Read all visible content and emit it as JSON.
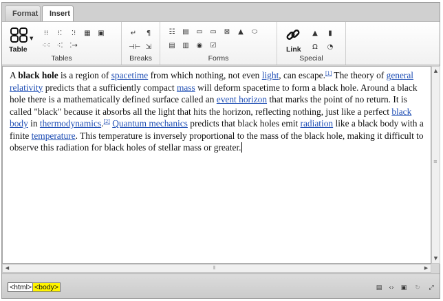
{
  "tabs": [
    {
      "label": "Format",
      "active": false
    },
    {
      "label": "Insert",
      "active": true
    }
  ],
  "ribbon": {
    "groups": {
      "tables": "Tables",
      "breaks": "Breaks",
      "forms": "Forms",
      "special": "Special"
    },
    "table_label": "Table",
    "link_label": "Link"
  },
  "content": {
    "p1": "A ",
    "b1": "black hole",
    "p2": " is a region of ",
    "l_spacetime": "spacetime",
    "p3": " from which nothing, not even ",
    "l_light": "light",
    "p4": ", can escape.",
    "sup1": "[1]",
    "p5": " The theory of ",
    "l_gr": "general relativity",
    "p6": " predicts that a sufficiently compact ",
    "l_mass": "mass",
    "p7": " will deform spacetime to form a black hole. Around a black hole there is a mathematically defined surface called an ",
    "l_horizon": "event horizon",
    "p8": " that marks the point of no return. It is called \"black\" because it absorbs all the light that hits the horizon, reflecting nothing, just like a perfect ",
    "l_blackbody": "black body",
    "p9": " in ",
    "l_thermo": "thermodynamics",
    "p10": ".",
    "sup2": "[2]",
    "p11": " ",
    "l_qm": "Quantum mechanics",
    "p12": " predicts that black holes emit ",
    "l_radiation": "radiation",
    "p13": " like a black body with a finite ",
    "l_temperature": "temperature",
    "p14": ". This temperature is inversely proportional to the mass of the black hole, making it difficult to observe this radiation for black holes of stellar mass or greater."
  },
  "statusbar": {
    "crumbs": [
      "<html>",
      "<body>"
    ]
  },
  "icons": {
    "table": "table-grid-icon",
    "link": "chain-link-icon"
  },
  "colors": {
    "link": "#1f4eb4",
    "active_crumb": "#fff400"
  }
}
